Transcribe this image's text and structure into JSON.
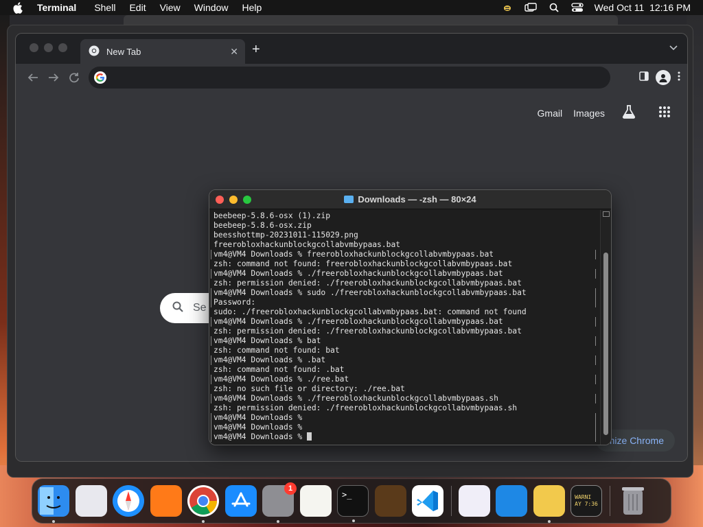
{
  "menubar": {
    "app": "Terminal",
    "items": [
      "Shell",
      "Edit",
      "View",
      "Window",
      "Help"
    ],
    "clock": "Wed Oct 11  12:16 PM"
  },
  "chrome": {
    "tab_title": "New Tab",
    "ntp_links": [
      "Gmail",
      "Images"
    ],
    "search_placeholder": "Se",
    "customize_label": "mize Chrome"
  },
  "terminal": {
    "title": "Downloads — -zsh — 80×24",
    "lines": [
      {
        "text": "beebeep-5.8.6-osx (1).zip",
        "prompt": false
      },
      {
        "text": "beebeep-5.8.6-osx.zip",
        "prompt": false
      },
      {
        "text": "beesshottmp-20231011-115029.png",
        "prompt": false
      },
      {
        "text": "freerobloxhackunblockgcollabvmbypaas.bat",
        "prompt": false
      },
      {
        "text": "vm4@VM4 Downloads % freerobloxhackunblockgcollabvmbypaas.bat",
        "prompt": true
      },
      {
        "text": "zsh: command not found: freerobloxhackunblockgcollabvmbypaas.bat",
        "prompt": false
      },
      {
        "text": "vm4@VM4 Downloads % ./freerobloxhackunblockgcollabvmbypaas.bat",
        "prompt": true
      },
      {
        "text": "zsh: permission denied: ./freerobloxhackunblockgcollabvmbypaas.bat",
        "prompt": false
      },
      {
        "text": "vm4@VM4 Downloads % sudo ./freerobloxhackunblockgcollabvmbypaas.bat",
        "prompt": true
      },
      {
        "text": "Password:",
        "prompt": true
      },
      {
        "text": "sudo: ./freerobloxhackunblockgcollabvmbypaas.bat: command not found",
        "prompt": false
      },
      {
        "text": "vm4@VM4 Downloads % ./freerobloxhackunblockgcollabvmbypaas.bat",
        "prompt": true
      },
      {
        "text": "zsh: permission denied: ./freerobloxhackunblockgcollabvmbypaas.bat",
        "prompt": false
      },
      {
        "text": "vm4@VM4 Downloads % bat",
        "prompt": true
      },
      {
        "text": "zsh: command not found: bat",
        "prompt": false
      },
      {
        "text": "vm4@VM4 Downloads % .bat",
        "prompt": true
      },
      {
        "text": "zsh: command not found: .bat",
        "prompt": false
      },
      {
        "text": "vm4@VM4 Downloads % ./ree.bat",
        "prompt": true
      },
      {
        "text": "zsh: no such file or directory: ./ree.bat",
        "prompt": false
      },
      {
        "text": "vm4@VM4 Downloads % ./freerobloxhackunblockgcollabvmbypaas.sh",
        "prompt": true
      },
      {
        "text": "zsh: permission denied: ./freerobloxhackunblockgcollabvmbypaas.sh",
        "prompt": false
      },
      {
        "text": "vm4@VM4 Downloads %",
        "prompt": true
      },
      {
        "text": "vm4@VM4 Downloads %",
        "prompt": true
      },
      {
        "text": "vm4@VM4 Downloads % ",
        "prompt": true,
        "cursor": true
      }
    ]
  },
  "dock": {
    "apps": [
      {
        "name": "finder",
        "color": "#2d8cf0"
      },
      {
        "name": "launchpad",
        "color": "#e8e8ee"
      },
      {
        "name": "safari",
        "color": "#1e90ff"
      },
      {
        "name": "firefox",
        "color": "#ff7a18"
      },
      {
        "name": "chrome",
        "color": "#ffffff"
      },
      {
        "name": "app-store",
        "color": "#1a8cff"
      },
      {
        "name": "system-settings",
        "color": "#8e8e93",
        "badge": "1"
      },
      {
        "name": "textedit",
        "color": "#f5f5f0"
      },
      {
        "name": "terminal",
        "color": "#111111"
      },
      {
        "name": "garageband",
        "color": "#5a3a1a"
      },
      {
        "name": "vscode",
        "color": "#0a78d4"
      },
      {
        "name": "visual-studio",
        "color": "#f0eef8"
      },
      {
        "name": "icloud-weather",
        "color": "#1e88e5"
      },
      {
        "name": "beebeep",
        "color": "#f2c94c"
      },
      {
        "name": "console",
        "color": "#1a1a1a",
        "text": "WARNI\nAY 7:36"
      },
      {
        "name": "trash",
        "color": "#6d6d72"
      }
    ]
  }
}
